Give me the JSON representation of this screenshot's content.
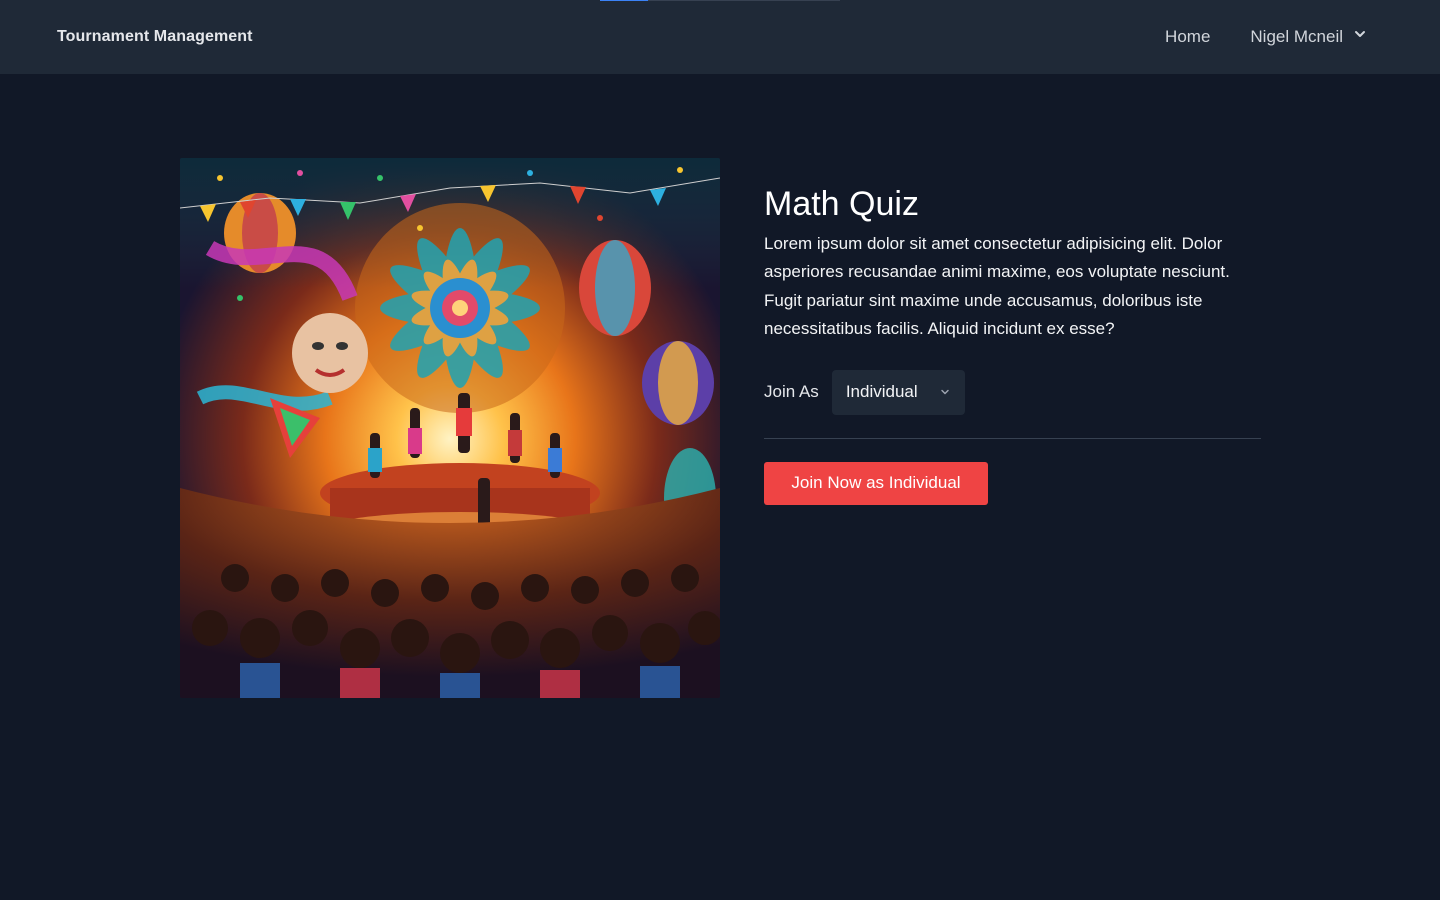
{
  "navbar": {
    "brand": "Tournament Management",
    "home_label": "Home",
    "user_name": "Nigel Mcneil",
    "progress": 0.2
  },
  "tournament": {
    "title": "Math Quiz",
    "description": "Lorem ipsum dolor sit amet consectetur adipisicing elit. Dolor asperiores recusandae animi maxime, eos voluptate nesciunt. Fugit pariatur sint maxime unde accusamus, doloribus iste necessitatibus facilis. Aliquid incidunt ex esse?",
    "join_as_label": "Join As",
    "join_as_selected": "Individual",
    "join_button_label": "Join Now as Individual"
  },
  "colors": {
    "background": "#111827",
    "navbar": "#1f2937",
    "accent_button": "#ef4444"
  },
  "icons": {
    "user_menu": "chevron-down-icon",
    "select": "chevron-down-icon"
  }
}
